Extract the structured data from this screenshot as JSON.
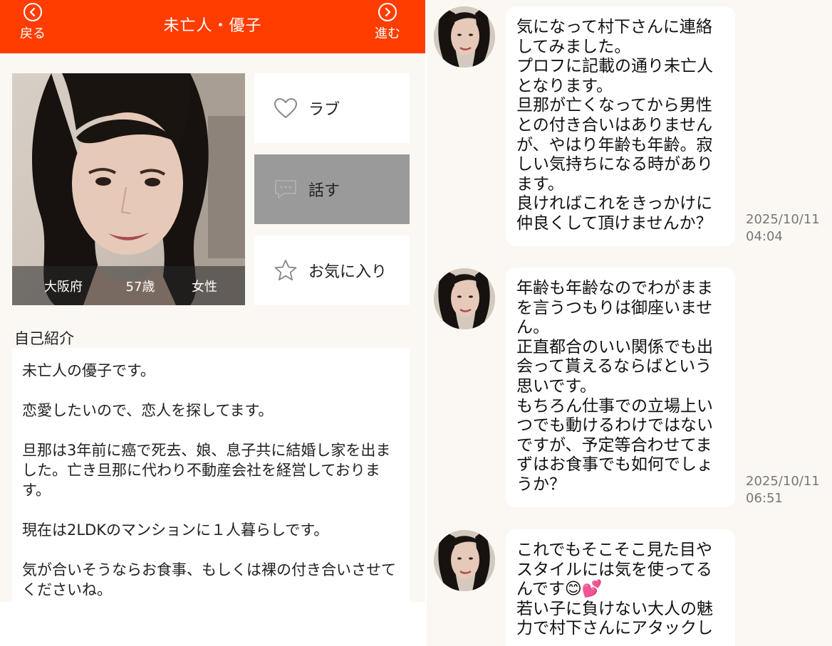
{
  "header": {
    "back_label": "戻る",
    "title": "未亡人・優子",
    "forward_label": "進む"
  },
  "profile": {
    "prefecture": "大阪府",
    "age": "57歳",
    "gender": "女性"
  },
  "actions": {
    "love": "ラブ",
    "talk": "話す",
    "favorite": "お気に入り"
  },
  "intro": {
    "heading": "自己紹介",
    "body": "未亡人の優子です。\n\n恋愛したいので、恋人を探してます。\n\n旦那は3年前に癌で死去、娘、息子共に結婚し家を出ました。亡き旦那に代わり不動産会社を経営しております。\n\n現在は2LDKのマンションに１人暮らしです。\n\n気が合いそうならお食事、もしくは裸の付き合いさせてくださいね。"
  },
  "messages": [
    {
      "text": "気になって村下さんに連絡してみました。\nプロフに記載の通り未亡人となります。\n旦那が亡くなってから男性との付き合いはありませんが、やはり年齢も年齢。寂しい気持ちになる時があります。\n良ければこれをきっかけに仲良くして頂けませんか？",
      "date": "2025/10/11",
      "time": "04:04"
    },
    {
      "text": "年齢も年齢なのでわがままを言うつもりは御座いません。\n正直都合のいい関係でも出会って貰えるならばという思いです。\nもちろん仕事での立場上いつでも動けるわけではないですが、予定等合わせてまずはお食事でも如何でしょうか？",
      "date": "2025/10/11",
      "time": "06:51"
    },
    {
      "text": "これでもそこそこ見た目やスタイルには気を使ってるんです😊💕\n若い子に負けない大人の魅力で村下さんにアタックし",
      "date": "",
      "time": ""
    }
  ],
  "colors": {
    "header": "#ff3d00",
    "background": "#fbf8f4",
    "talk_button": "#9a9a9a"
  },
  "icons": [
    "chevron-left-icon",
    "chevron-right-icon",
    "heart-icon",
    "chat-icon",
    "star-icon"
  ]
}
